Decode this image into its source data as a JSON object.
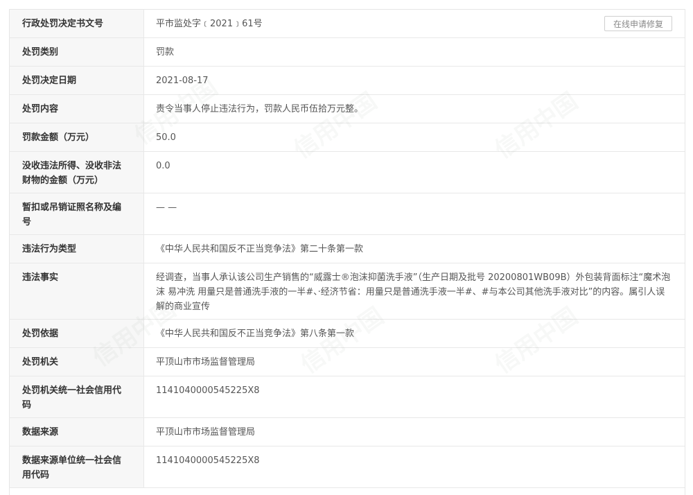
{
  "actions": {
    "repair_label": "在线申请修复"
  },
  "watermark": "信用中国",
  "rows": [
    {
      "label": "行政处罚决定书文号",
      "value": "平市监处字﹝2021﹞61号"
    },
    {
      "label": "处罚类别",
      "value": "罚款"
    },
    {
      "label": "处罚决定日期",
      "value": "2021-08-17"
    },
    {
      "label": "处罚内容",
      "value": "责令当事人停止违法行为，罚款人民币伍拾万元整。"
    },
    {
      "label": "罚款金额（万元）",
      "value": "50.0"
    },
    {
      "label": "没收违法所得、没收非法财物的金额（万元）",
      "value": "0.0"
    },
    {
      "label": "暂扣或吊销证照名称及编号",
      "value": "— —"
    },
    {
      "label": "违法行为类型",
      "value": "《中华人民共和国反不正当竞争法》第二十条第一款"
    },
    {
      "label": "违法事实",
      "value": "经调查，当事人承认该公司生产销售的“威露士®泡沫抑菌洗手液”（生产日期及批号 20200801WB09B）外包装背面标注“魔术泡沫 易冲洗 用量只是普通洗手液的一半#、·经济节省：用量只是普通洗手液一半#、#与本公司其他洗手液对比”的内容。属引人误解的商业宣传"
    },
    {
      "label": "处罚依据",
      "value": "《中华人民共和国反不正当竞争法》第八条第一款"
    },
    {
      "label": "处罚机关",
      "value": "平顶山市市场监督管理局"
    },
    {
      "label": "处罚机关统一社会信用代码",
      "value": "1141040000545225X8"
    },
    {
      "label": "数据来源",
      "value": "平顶山市市场监督管理局"
    },
    {
      "label": "数据来源单位统一社会信用代码",
      "value": "1141040000545225X8"
    }
  ]
}
